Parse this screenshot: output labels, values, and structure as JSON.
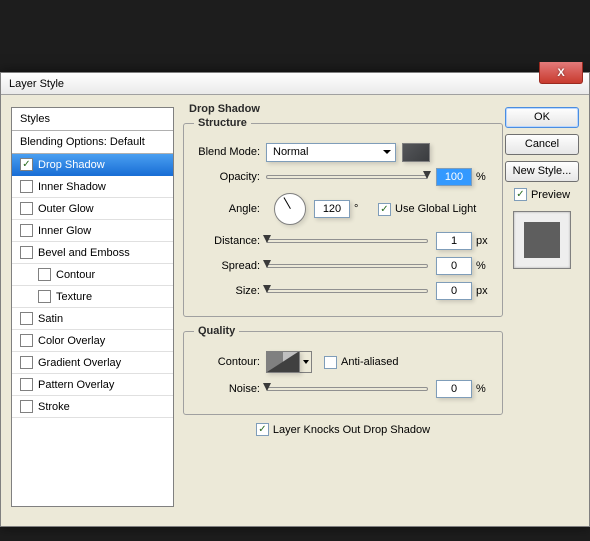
{
  "window": {
    "title": "Layer Style",
    "close": "X"
  },
  "styles": {
    "header": "Styles",
    "blending": "Blending Options: Default",
    "items": [
      {
        "label": "Drop Shadow",
        "checked": true,
        "selected": true,
        "indent": false
      },
      {
        "label": "Inner Shadow",
        "checked": false,
        "selected": false,
        "indent": false
      },
      {
        "label": "Outer Glow",
        "checked": false,
        "selected": false,
        "indent": false
      },
      {
        "label": "Inner Glow",
        "checked": false,
        "selected": false,
        "indent": false
      },
      {
        "label": "Bevel and Emboss",
        "checked": false,
        "selected": false,
        "indent": false
      },
      {
        "label": "Contour",
        "checked": false,
        "selected": false,
        "indent": true
      },
      {
        "label": "Texture",
        "checked": false,
        "selected": false,
        "indent": true
      },
      {
        "label": "Satin",
        "checked": false,
        "selected": false,
        "indent": false
      },
      {
        "label": "Color Overlay",
        "checked": false,
        "selected": false,
        "indent": false
      },
      {
        "label": "Gradient Overlay",
        "checked": false,
        "selected": false,
        "indent": false
      },
      {
        "label": "Pattern Overlay",
        "checked": false,
        "selected": false,
        "indent": false
      },
      {
        "label": "Stroke",
        "checked": false,
        "selected": false,
        "indent": false
      }
    ]
  },
  "panel": {
    "title": "Drop Shadow",
    "structure_legend": "Structure",
    "quality_legend": "Quality",
    "blend_mode_label": "Blend Mode:",
    "blend_mode_value": "Normal",
    "opacity_label": "Opacity:",
    "opacity_value": "100",
    "opacity_unit": "%",
    "angle_label": "Angle:",
    "angle_value": "120",
    "angle_unit": "°",
    "use_global_label": "Use Global Light",
    "use_global_checked": true,
    "distance_label": "Distance:",
    "distance_value": "1",
    "distance_unit": "px",
    "spread_label": "Spread:",
    "spread_value": "0",
    "spread_unit": "%",
    "size_label": "Size:",
    "size_value": "0",
    "size_unit": "px",
    "contour_label": "Contour:",
    "aa_label": "Anti-aliased",
    "aa_checked": false,
    "noise_label": "Noise:",
    "noise_value": "0",
    "noise_unit": "%",
    "knockout_label": "Layer Knocks Out Drop Shadow",
    "knockout_checked": true
  },
  "buttons": {
    "ok": "OK",
    "cancel": "Cancel",
    "new_style": "New Style...",
    "preview": "Preview"
  }
}
